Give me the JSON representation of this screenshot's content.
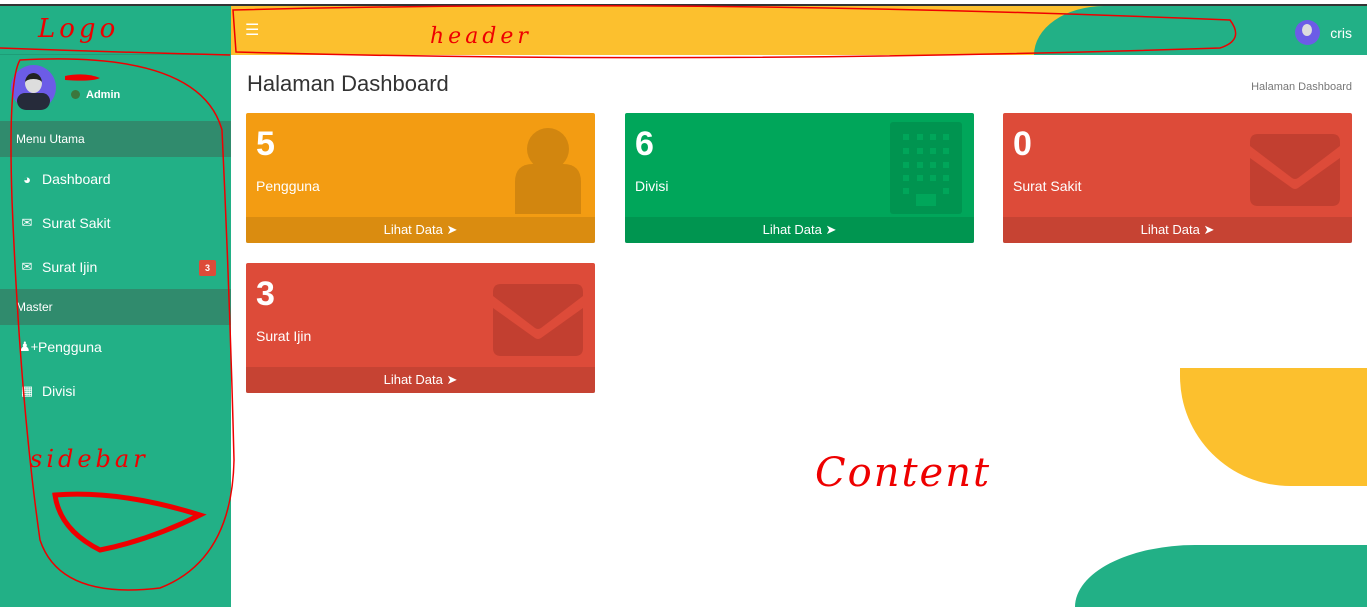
{
  "header": {
    "menu_icon": "bars-icon",
    "username": "cris"
  },
  "sidebar": {
    "user_status": "Admin",
    "sections": [
      {
        "label": "Menu Utama",
        "items": [
          {
            "label": "Dashboard",
            "icon": "dashboard-icon"
          },
          {
            "label": "Surat Sakit",
            "icon": "envelope-icon"
          },
          {
            "label": "Surat Ijin",
            "icon": "envelope-icon",
            "badge": "3"
          }
        ]
      },
      {
        "label": "Master",
        "items": [
          {
            "label": "Pengguna",
            "icon": "user-plus-icon"
          },
          {
            "label": "Divisi",
            "icon": "building-icon"
          }
        ]
      }
    ]
  },
  "content": {
    "title": "Halaman Dashboard",
    "breadcrumb": "Halaman Dashboard",
    "cards": [
      {
        "count": "5",
        "label": "Pengguna",
        "link": "Lihat Data",
        "color": "#f39c12"
      },
      {
        "count": "6",
        "label": "Divisi",
        "link": "Lihat Data",
        "color": "#00a65a"
      },
      {
        "count": "0",
        "label": "Surat Sakit",
        "link": "Lihat Data",
        "color": "#dd4b39"
      },
      {
        "count": "3",
        "label": "Surat Ijin",
        "link": "Lihat Data",
        "color": "#dd4b39"
      }
    ]
  },
  "annotations": {
    "logo": "Logo",
    "header": "header",
    "sidebar": "sidebar",
    "content": "Content"
  }
}
